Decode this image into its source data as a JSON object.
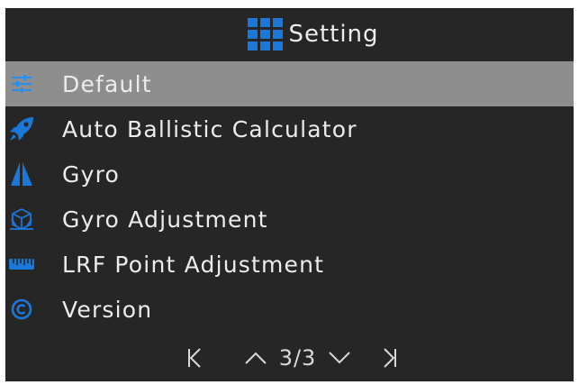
{
  "header": {
    "icon": "grid-icon",
    "title": "Setting"
  },
  "colors": {
    "background": "#262626",
    "selected_row": "#8e8e8e",
    "icon_blue": "#1b78d8",
    "text": "#ececec"
  },
  "menu": {
    "items": [
      {
        "label": "Default",
        "icon": "sliders-icon",
        "selected": true
      },
      {
        "label": "Auto Ballistic Calculator",
        "icon": "rocket-icon",
        "selected": false
      },
      {
        "label": "Gyro",
        "icon": "gyro-icon",
        "selected": false
      },
      {
        "label": "Gyro Adjustment",
        "icon": "cube-adjust-icon",
        "selected": false
      },
      {
        "label": "LRF Point Adjustment",
        "icon": "ruler-icon",
        "selected": false
      },
      {
        "label": "Version",
        "icon": "copyright-icon",
        "selected": false
      }
    ]
  },
  "pager": {
    "page_label": "3/3",
    "first_icon": "first-page-icon",
    "prev_icon": "chevron-up-icon",
    "next_icon": "chevron-down-icon",
    "last_icon": "last-page-icon"
  }
}
